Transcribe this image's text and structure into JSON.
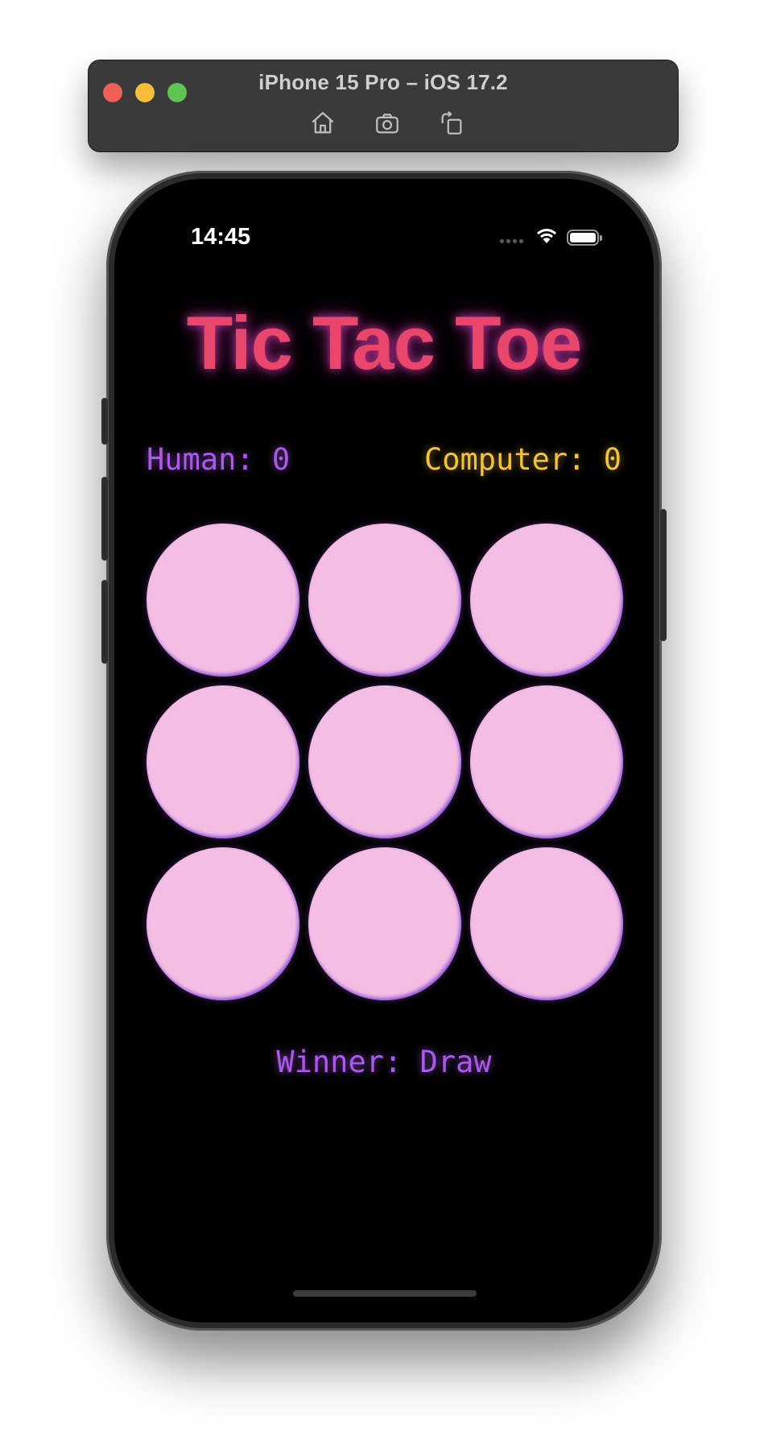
{
  "simulator": {
    "title": "iPhone 15 Pro – iOS 17.2",
    "buttons": [
      "home-icon",
      "screenshot-icon",
      "rotate-icon"
    ]
  },
  "status_bar": {
    "time": "14:45"
  },
  "game": {
    "title": "Tic Tac Toe",
    "human_score": "Human: 0",
    "computer_score": "Computer: 0",
    "winner": "Winner: Draw",
    "cells": [
      "",
      "",
      "",
      "",
      "",
      "",
      "",
      "",
      ""
    ]
  },
  "colors": {
    "title": "#e8466b",
    "human": "#a95ae8",
    "computer": "#f4c23c",
    "cell": "#f4bde3",
    "screen_bg": "#000000"
  }
}
